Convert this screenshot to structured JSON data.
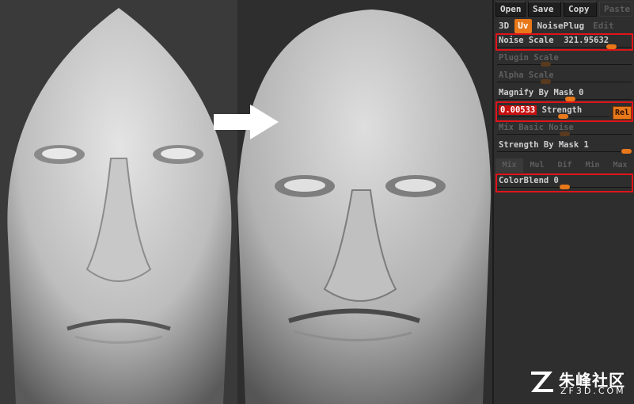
{
  "toolbar": {
    "open": "Open",
    "save": "Save",
    "copy": "Copy",
    "paste": "Paste"
  },
  "tabs": {
    "t3d": "3D",
    "uv": "Uv",
    "noiseplug": "NoisePlug",
    "edit": "Edit"
  },
  "noise_scale": {
    "label": "Noise Scale",
    "value": "321.95632",
    "level": 0.88
  },
  "plugin_scale": {
    "label": "Plugin Scale",
    "level": 0.35
  },
  "alpha_scale": {
    "label": "Alpha Scale",
    "level": 0.35
  },
  "magnify_by_mask": {
    "label": "Magnify By Mask",
    "value": "0",
    "level": 0.55
  },
  "strength": {
    "value": "0.00533",
    "label": "Strength",
    "level": 0.6
  },
  "rel_button": "Rel",
  "mix_basic_noise": {
    "label": "Mix Basic Noise",
    "level": 0.5
  },
  "strength_by_mask": {
    "label": "Strength By Mask",
    "value": "1",
    "level": 1.0
  },
  "mix_modes": [
    "Mix",
    "Mul",
    "Dif",
    "Min",
    "Max"
  ],
  "color_blend": {
    "label": "ColorBlend",
    "value": "0",
    "level": 0.5
  },
  "watermark": {
    "brand": "朱峰社区",
    "domain": "ZF3D.COM"
  },
  "colors": {
    "accent": "#e8781a",
    "highlight": "#e0141a"
  }
}
